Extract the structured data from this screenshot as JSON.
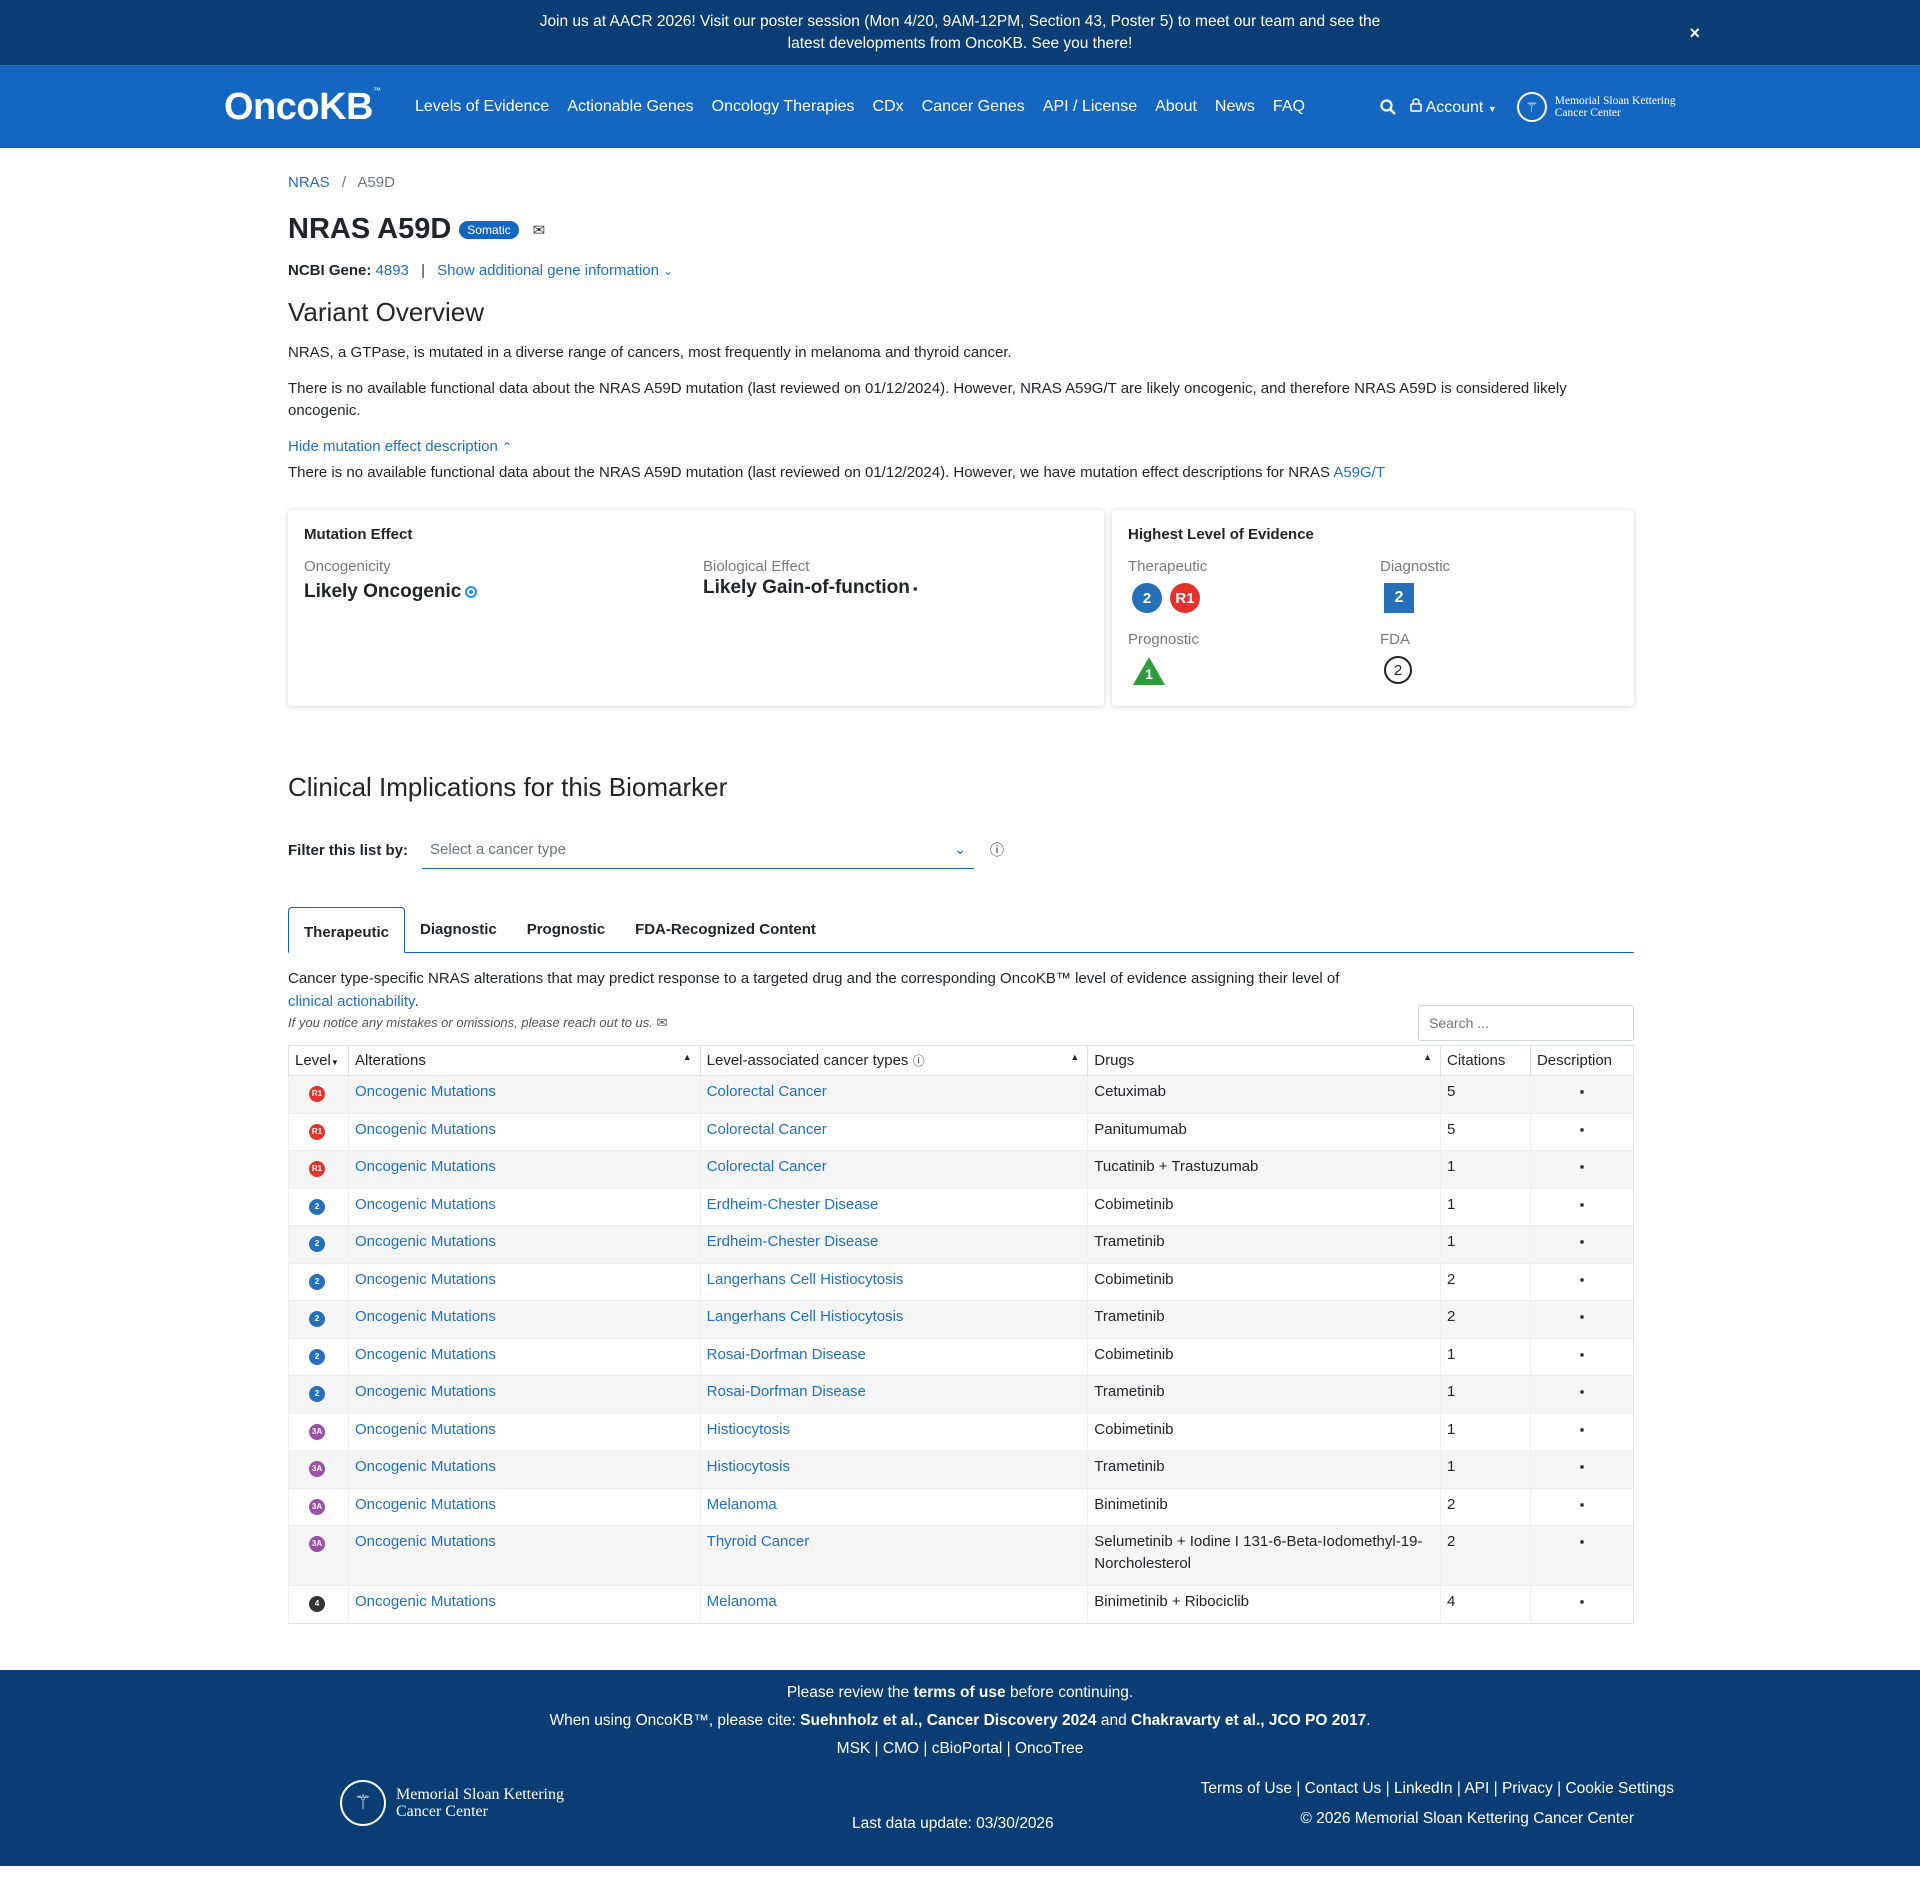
{
  "announcement": {
    "text": "Join us at AACR 2026! Visit our poster session (Mon 4/20, 9AM-12PM, Section 43, Poster 5) to meet our team and see the latest developments from OncoKB. See you there!",
    "close": "×"
  },
  "nav": {
    "logo": "OncoKB",
    "logo_tm": "™",
    "items": [
      "Levels of Evidence",
      "Actionable Genes",
      "Oncology Therapies",
      "CDx",
      "Cancer Genes",
      "API / License",
      "About",
      "News",
      "FAQ"
    ],
    "account": "Account",
    "msk_line1": "Memorial Sloan Kettering",
    "msk_line2": "Cancer Center"
  },
  "breadcrumb": {
    "gene": "NRAS",
    "sep": "/",
    "variant": "A59D"
  },
  "header": {
    "title": "NRAS A59D",
    "badge": "Somatic"
  },
  "ncbi": {
    "label": "NCBI Gene:",
    "id": "4893",
    "pipe": "|",
    "more": "Show additional gene information"
  },
  "overview": {
    "heading": "Variant Overview",
    "p1": "NRAS, a GTPase, is mutated in a diverse range of cancers, most frequently in melanoma and thyroid cancer.",
    "p2": "There is no available functional data about the NRAS A59D mutation (last reviewed on 01/12/2024). However, NRAS A59G/T are likely oncogenic, and therefore NRAS A59D is considered likely oncogenic.",
    "hide_link": "Hide mutation effect description",
    "p3": "There is no available functional data about the NRAS A59D mutation (last reviewed on 01/12/2024). However, we have mutation effect descriptions for NRAS",
    "p3_link": "A59G/T"
  },
  "mutation_effect": {
    "heading": "Mutation Effect",
    "onco_label": "Oncogenicity",
    "onco_value": "Likely Oncogenic",
    "bio_label": "Biological Effect",
    "bio_value": "Likely Gain-of-function"
  },
  "highest_level": {
    "heading": "Highest Level of Evidence",
    "therapeutic_label": "Therapeutic",
    "therapeutic_levels": [
      "2",
      "R1"
    ],
    "diagnostic_label": "Diagnostic",
    "diagnostic_level": "2",
    "prognostic_label": "Prognostic",
    "prognostic_level": "1",
    "fda_label": "FDA",
    "fda_level": "2"
  },
  "clinical": {
    "heading": "Clinical Implications for this Biomarker",
    "filter_label": "Filter this list by:",
    "filter_placeholder": "Select a cancer type",
    "tabs": [
      "Therapeutic",
      "Diagnostic",
      "Prognostic",
      "FDA-Recognized Content"
    ],
    "desc_1": "Cancer type-specific NRAS alterations that may predict response to a targeted drug and the corresponding OncoKB™ level of evidence assigning their level of",
    "desc_link": "clinical actionability",
    "desc_end": ".",
    "notice": "If you notice any mistakes or omissions, please reach out to us.",
    "search_placeholder": "Search ..."
  },
  "table": {
    "headers": [
      "Level",
      "Alterations",
      "Level-associated cancer types",
      "Drugs",
      "Citations",
      "Description"
    ],
    "rows": [
      {
        "level": "R1",
        "alt": "Oncogenic Mutations",
        "cancer": "Colorectal Cancer",
        "drug": "Cetuximab",
        "cit": "5"
      },
      {
        "level": "R1",
        "alt": "Oncogenic Mutations",
        "cancer": "Colorectal Cancer",
        "drug": "Panitumumab",
        "cit": "5"
      },
      {
        "level": "R1",
        "alt": "Oncogenic Mutations",
        "cancer": "Colorectal Cancer",
        "drug": "Tucatinib + Trastuzumab",
        "cit": "1"
      },
      {
        "level": "2",
        "alt": "Oncogenic Mutations",
        "cancer": "Erdheim-Chester Disease",
        "drug": "Cobimetinib",
        "cit": "1"
      },
      {
        "level": "2",
        "alt": "Oncogenic Mutations",
        "cancer": "Erdheim-Chester Disease",
        "drug": "Trametinib",
        "cit": "1"
      },
      {
        "level": "2",
        "alt": "Oncogenic Mutations",
        "cancer": "Langerhans Cell Histiocytosis",
        "drug": "Cobimetinib",
        "cit": "2"
      },
      {
        "level": "2",
        "alt": "Oncogenic Mutations",
        "cancer": "Langerhans Cell Histiocytosis",
        "drug": "Trametinib",
        "cit": "2"
      },
      {
        "level": "2",
        "alt": "Oncogenic Mutations",
        "cancer": "Rosai-Dorfman Disease",
        "drug": "Cobimetinib",
        "cit": "1"
      },
      {
        "level": "2",
        "alt": "Oncogenic Mutations",
        "cancer": "Rosai-Dorfman Disease",
        "drug": "Trametinib",
        "cit": "1"
      },
      {
        "level": "3A",
        "alt": "Oncogenic Mutations",
        "cancer": "Histiocytosis",
        "drug": "Cobimetinib",
        "cit": "1"
      },
      {
        "level": "3A",
        "alt": "Oncogenic Mutations",
        "cancer": "Histiocytosis",
        "drug": "Trametinib",
        "cit": "1"
      },
      {
        "level": "3A",
        "alt": "Oncogenic Mutations",
        "cancer": "Melanoma",
        "drug": "Binimetinib",
        "cit": "2"
      },
      {
        "level": "3A",
        "alt": "Oncogenic Mutations",
        "cancer": "Thyroid Cancer",
        "drug": "Selumetinib + Iodine I 131-6-Beta-Iodomethyl-19-Norcholesterol",
        "cit": "2"
      },
      {
        "level": "4",
        "alt": "Oncogenic Mutations",
        "cancer": "Melanoma",
        "drug": "Binimetinib + Ribociclib",
        "cit": "4"
      }
    ]
  },
  "level_colors": {
    "R1": "#e2322b",
    "2": "#2570b8",
    "3A": "#9c4ea8",
    "4": "#333333",
    "prognostic_1": "#2f9c3a"
  },
  "footer": {
    "terms_pre": "Please review the",
    "terms_bold": "terms of use",
    "terms_post": "before continuing.",
    "cite_pre": "When using OncoKB™, please cite:",
    "cite_1": "Suehnholz et al., Cancer Discovery 2024",
    "cite_and": "and",
    "cite_2": "Chakravarty et al., JCO PO 2017",
    "cite_end": ".",
    "links_center": [
      "MSK",
      "CMO",
      "cBioPortal",
      "OncoTree"
    ],
    "last_update": "Last data update: 03/30/2026",
    "links_right": [
      "Terms of Use",
      "Contact Us",
      "LinkedIn",
      "API",
      "Privacy",
      "Cookie Settings"
    ],
    "copyright": "© 2026 Memorial Sloan Kettering Cancer Center",
    "msk_line1": "Memorial Sloan Kettering",
    "msk_line2": "Cancer Center"
  }
}
